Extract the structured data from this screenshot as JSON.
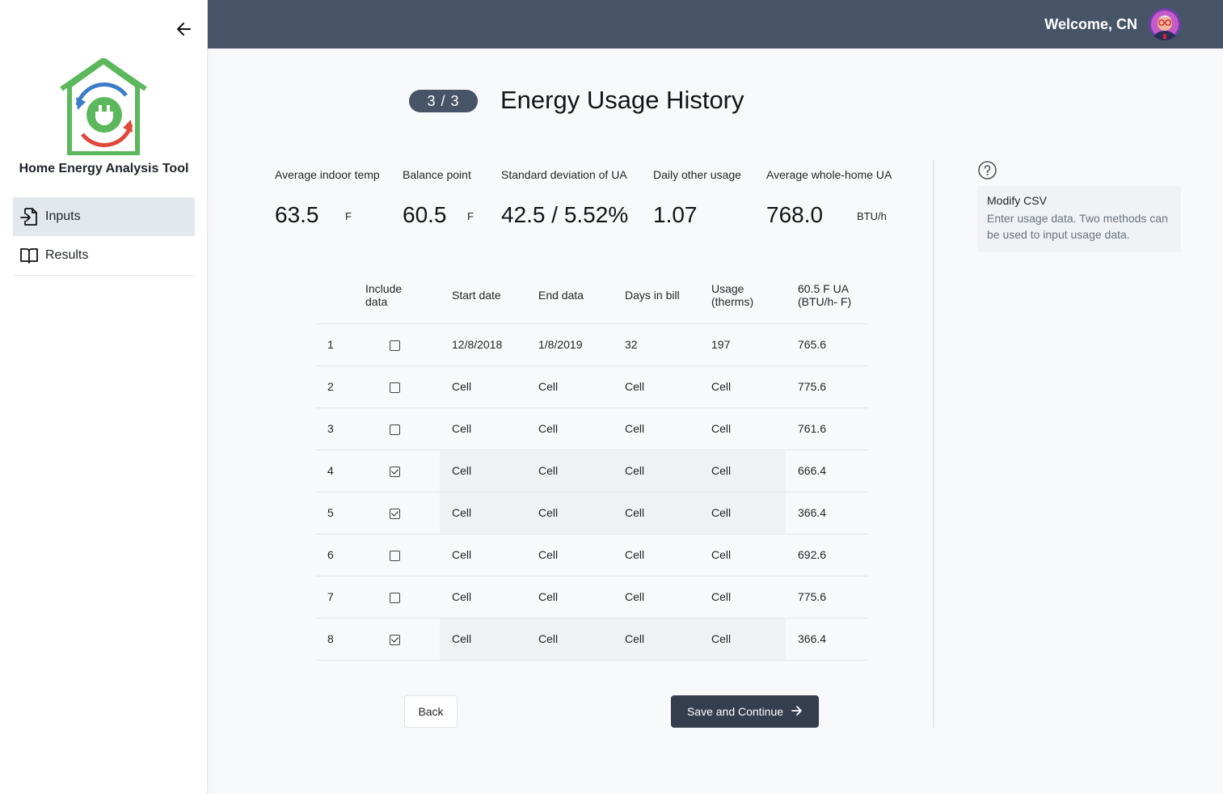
{
  "sidebar": {
    "app_name": "Home Energy Analysis Tool",
    "nav": [
      {
        "label": "Inputs",
        "icon": "file-import-icon",
        "active": true
      },
      {
        "label": "Results",
        "icon": "book-open-icon",
        "active": false
      }
    ]
  },
  "header": {
    "welcome": "Welcome, CN"
  },
  "title": {
    "step": "3 / 3",
    "text": "Energy Usage History"
  },
  "stats": [
    {
      "label": "Average indoor temp",
      "value": "63.5",
      "unit": "F"
    },
    {
      "label": "Balance point",
      "value": "60.5",
      "unit": "F"
    },
    {
      "label": "Standard deviation of UA",
      "value": "42.5 / 5.52%",
      "unit": ""
    },
    {
      "label": "Daily other usage",
      "value": "1.07",
      "unit": ""
    },
    {
      "label": "Average whole-home UA",
      "value": "768.0",
      "unit": "BTU/h"
    }
  ],
  "table": {
    "headers": [
      "",
      "Include data",
      "Start date",
      "End data",
      "Days in bill",
      "Usage (therms)",
      "60.5 F UA (BTU/h- F)"
    ],
    "header_lines": {
      "include": [
        "Include",
        "data"
      ],
      "usage": [
        "Usage",
        "(therms)"
      ],
      "ua": [
        "60.5 F UA",
        "(BTU/h- F)"
      ]
    },
    "rows": [
      {
        "n": "1",
        "include": false,
        "start": "12/8/2018",
        "end": "1/8/2019",
        "days": "32",
        "usage": "197",
        "ua": "765.6"
      },
      {
        "n": "2",
        "include": false,
        "start": "Cell",
        "end": "Cell",
        "days": "Cell",
        "usage": "Cell",
        "ua": "775.6"
      },
      {
        "n": "3",
        "include": false,
        "start": "Cell",
        "end": "Cell",
        "days": "Cell",
        "usage": "Cell",
        "ua": "761.6"
      },
      {
        "n": "4",
        "include": true,
        "start": "Cell",
        "end": "Cell",
        "days": "Cell",
        "usage": "Cell",
        "ua": "666.4"
      },
      {
        "n": "5",
        "include": true,
        "start": "Cell",
        "end": "Cell",
        "days": "Cell",
        "usage": "Cell",
        "ua": "366.4"
      },
      {
        "n": "6",
        "include": false,
        "start": "Cell",
        "end": "Cell",
        "days": "Cell",
        "usage": "Cell",
        "ua": "692.6"
      },
      {
        "n": "7",
        "include": false,
        "start": "Cell",
        "end": "Cell",
        "days": "Cell",
        "usage": "Cell",
        "ua": "775.6"
      },
      {
        "n": "8",
        "include": true,
        "start": "Cell",
        "end": "Cell",
        "days": "Cell",
        "usage": "Cell",
        "ua": "366.4"
      }
    ]
  },
  "buttons": {
    "back": "Back",
    "save": "Save and Continue"
  },
  "help": {
    "title": "Modify CSV",
    "description": "Enter usage data. Two methods can be used to input usage data."
  },
  "colors": {
    "header_bg": "#475467",
    "primary_button": "#343e4f",
    "logo_green": "#5cb85c",
    "logo_blue": "#3d7cc9",
    "logo_red": "#e0473a"
  }
}
